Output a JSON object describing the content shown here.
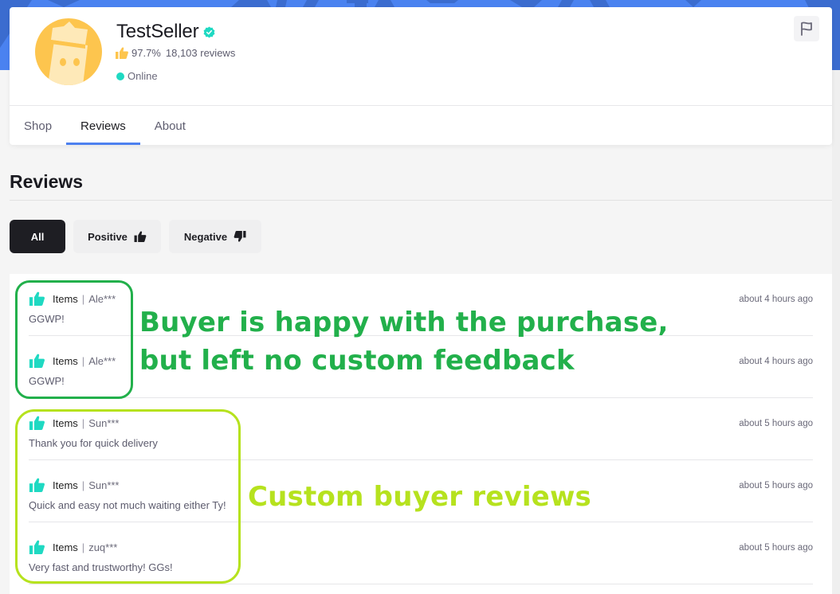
{
  "banner": {
    "color": "#4a82f0",
    "pattern_color": "#3b6ccf"
  },
  "seller": {
    "name": "TestSeller",
    "verified_icon": "verified-check-icon",
    "verified_color": "#1fd9c2",
    "rating_icon": "thumbs-up-icon",
    "rating_color": "#fdc54e",
    "rating_percent": "97.7%",
    "review_count": "18,103 reviews",
    "status": "Online",
    "status_color": "#1fd9c2",
    "avatar_color": "#fdc54e",
    "report_icon": "flag-icon"
  },
  "tabs": [
    {
      "label": "Shop",
      "active": false
    },
    {
      "label": "Reviews",
      "active": true
    },
    {
      "label": "About",
      "active": false
    }
  ],
  "accent_color": "#4c80ef",
  "reviews_section": {
    "title": "Reviews",
    "filters": [
      {
        "label": "All",
        "active": true
      },
      {
        "label": "Positive",
        "icon": "thumbs-up-icon",
        "active": false
      },
      {
        "label": "Negative",
        "icon": "thumbs-down-icon",
        "active": false
      }
    ],
    "items": [
      {
        "sentiment": "positive",
        "category": "Items",
        "user": "Ale***",
        "text": "GGWP!",
        "time": "about 4 hours ago"
      },
      {
        "sentiment": "positive",
        "category": "Items",
        "user": "Ale***",
        "text": "GGWP!",
        "time": "about 4 hours ago"
      },
      {
        "sentiment": "positive",
        "category": "Items",
        "user": "Sun***",
        "text": "Thank you for quick delivery",
        "time": "about 5 hours ago"
      },
      {
        "sentiment": "positive",
        "category": "Items",
        "user": "Sun***",
        "text": "Quick and easy not much waiting either Ty!",
        "time": "about 5 hours ago"
      },
      {
        "sentiment": "positive",
        "category": "Items",
        "user": "zuq***",
        "text": "Very fast and trustworthy! GGs!",
        "time": "about 5 hours ago"
      }
    ],
    "separator": "|",
    "positive_color": "#1fd9c2"
  },
  "annotations": [
    {
      "lines": [
        "Buyer is happy with the purchase,",
        "but left no custom feedback"
      ],
      "color": "#22b04b"
    },
    {
      "lines": [
        "Custom buyer reviews"
      ],
      "color": "#b6e21e"
    }
  ]
}
